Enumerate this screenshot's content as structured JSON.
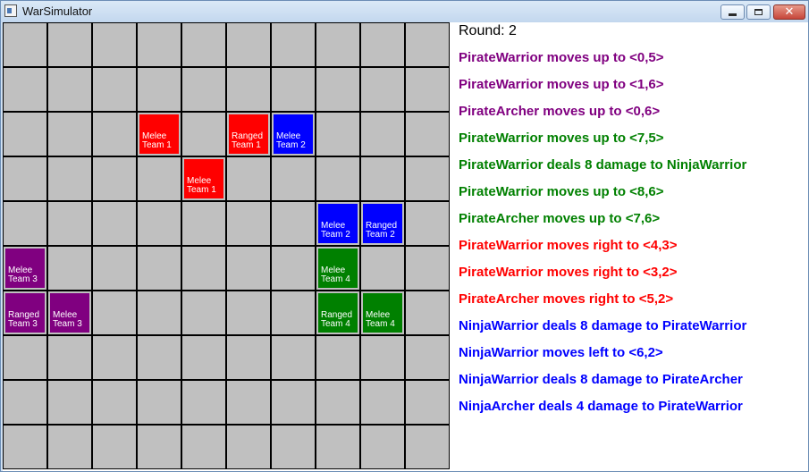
{
  "window": {
    "title": "WarSimulator"
  },
  "colors": {
    "team1": "#ff0000",
    "team2": "#0000ff",
    "team3": "#800080",
    "team4": "#008000",
    "cell": "#c0c0c0",
    "gridline": "#000000"
  },
  "board": {
    "columns": 10,
    "rows": 10,
    "units": [
      {
        "col": 3,
        "row": 2,
        "type": "Melee",
        "team": "Team 1",
        "team_id": 1
      },
      {
        "col": 5,
        "row": 2,
        "type": "Ranged",
        "team": "Team 1",
        "team_id": 1
      },
      {
        "col": 6,
        "row": 2,
        "type": "Melee",
        "team": "Team 2",
        "team_id": 2
      },
      {
        "col": 4,
        "row": 3,
        "type": "Melee",
        "team": "Team 1",
        "team_id": 1
      },
      {
        "col": 7,
        "row": 4,
        "type": "Melee",
        "team": "Team 2",
        "team_id": 2
      },
      {
        "col": 8,
        "row": 4,
        "type": "Ranged",
        "team": "Team 2",
        "team_id": 2
      },
      {
        "col": 0,
        "row": 5,
        "type": "Melee",
        "team": "Team 3",
        "team_id": 3
      },
      {
        "col": 7,
        "row": 5,
        "type": "Melee",
        "team": "Team 4",
        "team_id": 4
      },
      {
        "col": 0,
        "row": 6,
        "type": "Ranged",
        "team": "Team 3",
        "team_id": 3
      },
      {
        "col": 1,
        "row": 6,
        "type": "Melee",
        "team": "Team 3",
        "team_id": 3
      },
      {
        "col": 7,
        "row": 6,
        "type": "Ranged",
        "team": "Team 4",
        "team_id": 4
      },
      {
        "col": 8,
        "row": 6,
        "type": "Melee",
        "team": "Team 4",
        "team_id": 4
      }
    ]
  },
  "log": {
    "round": "Round: 2",
    "messages": [
      {
        "text": "PirateWarrior moves up to <0,5>",
        "color": "#800080"
      },
      {
        "text": "PirateWarrior moves up to <1,6>",
        "color": "#800080"
      },
      {
        "text": "PirateArcher moves up to <0,6>",
        "color": "#800080"
      },
      {
        "text": "PirateWarrior moves up to <7,5>",
        "color": "#008000"
      },
      {
        "text": "PirateWarrior deals 8 damage to NinjaWarrior",
        "color": "#008000"
      },
      {
        "text": "PirateWarrior moves up to <8,6>",
        "color": "#008000"
      },
      {
        "text": "PirateArcher moves up to <7,6>",
        "color": "#008000"
      },
      {
        "text": "PirateWarrior moves right to <4,3>",
        "color": "#ff0000"
      },
      {
        "text": "PirateWarrior moves right to <3,2>",
        "color": "#ff0000"
      },
      {
        "text": "PirateArcher moves right to <5,2>",
        "color": "#ff0000"
      },
      {
        "text": "NinjaWarrior deals 8 damage to PirateWarrior",
        "color": "#0000ff"
      },
      {
        "text": "NinjaWarrior moves left to <6,2>",
        "color": "#0000ff"
      },
      {
        "text": "NinjaWarrior deals 8 damage to PirateArcher",
        "color": "#0000ff"
      },
      {
        "text": "NinjaArcher deals 4 damage to PirateWarrior",
        "color": "#0000ff"
      }
    ]
  }
}
